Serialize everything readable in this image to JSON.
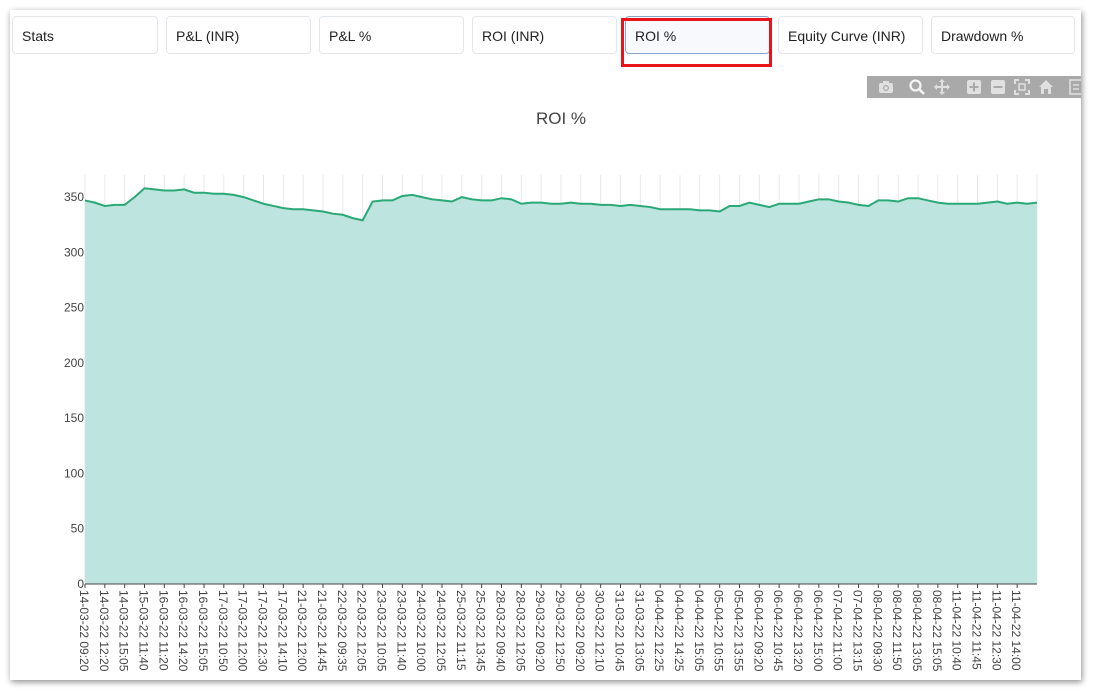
{
  "tabs": [
    {
      "label": "Stats",
      "active": false
    },
    {
      "label": "P&L (INR)",
      "active": false
    },
    {
      "label": "P&L %",
      "active": false
    },
    {
      "label": "ROI (INR)",
      "active": false
    },
    {
      "label": "ROI %",
      "active": true
    },
    {
      "label": "Equity Curve (INR)",
      "active": false
    },
    {
      "label": "Drawdown %",
      "active": false
    }
  ],
  "modebar": {
    "icons": [
      "camera-icon",
      "zoom-icon",
      "pan-icon",
      "zoom-in-icon",
      "zoom-out-icon",
      "autoscale-icon",
      "reset-axes-icon",
      "compare-data-icon"
    ]
  },
  "colors": {
    "line": "#2aa876",
    "fill": "#bde4df",
    "highlight": "#e8141a",
    "modebar": "#a9a9a9"
  },
  "chart_data": {
    "type": "area",
    "title": "ROI %",
    "xlabel": "",
    "ylabel": "",
    "ylim": [
      0,
      370
    ],
    "yticks": [
      0,
      50,
      100,
      150,
      200,
      250,
      300,
      350
    ],
    "grid": true,
    "legend": "none",
    "x": [
      "14-03-22 09:20",
      "",
      "14-03-22 12:20",
      "",
      "14-03-22 15:05",
      "",
      "15-03-22 11:40",
      "",
      "16-03-22 11:20",
      "",
      "16-03-22 14:20",
      "",
      "16-03-22 15:05",
      "",
      "17-03-22 10:50",
      "",
      "17-03-22 12:00",
      "",
      "17-03-22 12:30",
      "",
      "17-03-22 14:10",
      "",
      "21-03-22 12:00",
      "",
      "21-03-22 14:45",
      "",
      "22-03-22 09:35",
      "",
      "22-03-22 12:05",
      "",
      "23-03-22 10:05",
      "",
      "23-03-22 11:40",
      "",
      "24-03-22 10:00",
      "",
      "24-03-22 12:05",
      "",
      "25-03-22 11:15",
      "",
      "25-03-22 13:45",
      "",
      "28-03-22 09:40",
      "",
      "28-03-22 12:05",
      "",
      "29-03-22 09:20",
      "",
      "29-03-22 12:50",
      "",
      "30-03-22 09:20",
      "",
      "30-03-22 12:10",
      "",
      "31-03-22 10:45",
      "",
      "31-03-22 13:05",
      "",
      "04-04-22 12:25",
      "",
      "04-04-22 14:25",
      "",
      "04-04-22 15:05",
      "",
      "05-04-22 10:55",
      "",
      "05-04-22 13:55",
      "",
      "06-04-22 09:20",
      "",
      "06-04-22 10:45",
      "",
      "06-04-22 13:20",
      "",
      "06-04-22 15:00",
      "",
      "07-04-22 11:00",
      "",
      "07-04-22 13:15",
      "",
      "08-04-22 09:30",
      "",
      "08-04-22 11:50",
      "",
      "08-04-22 13:05",
      "",
      "08-04-22 15:05",
      "",
      "11-04-22 10:40",
      "",
      "11-04-22 11:45",
      "",
      "11-04-22 12:30",
      "",
      "11-04-22 14:00"
    ],
    "values": [
      347,
      345,
      342,
      343,
      343,
      350,
      358,
      357,
      356,
      356,
      357,
      354,
      354,
      353,
      353,
      352,
      350,
      347,
      344,
      342,
      340,
      339,
      339,
      338,
      337,
      335,
      334,
      331,
      329,
      346,
      347,
      347,
      351,
      352,
      350,
      348,
      347,
      346,
      350,
      348,
      347,
      347,
      349,
      348,
      344,
      345,
      345,
      344,
      344,
      345,
      344,
      344,
      343,
      343,
      342,
      343,
      342,
      341,
      339,
      339,
      339,
      339,
      338,
      338,
      337,
      342,
      342,
      345,
      343,
      341,
      344,
      344,
      344,
      346,
      348,
      348,
      346,
      345,
      343,
      342,
      347,
      347,
      346,
      349,
      349,
      347,
      345,
      344,
      344,
      344,
      344,
      345,
      346,
      344,
      345,
      344,
      345
    ]
  }
}
